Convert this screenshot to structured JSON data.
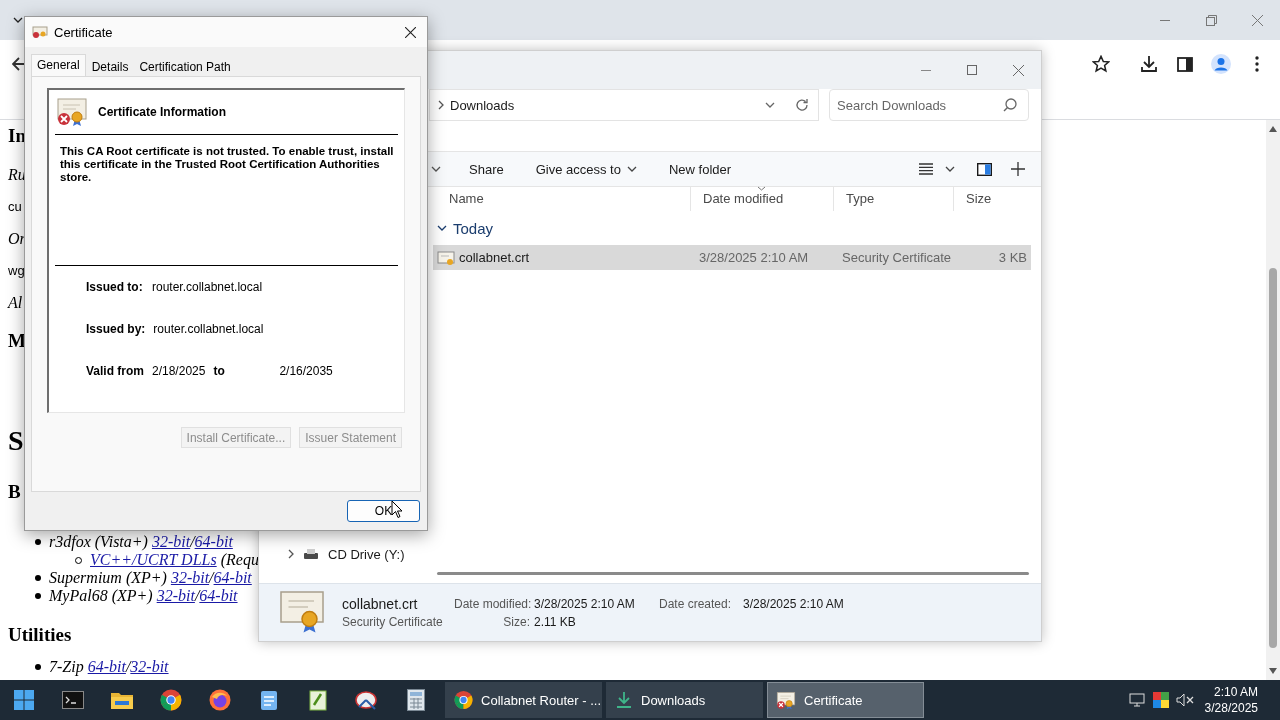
{
  "browser": {
    "page": {
      "blocks": [
        {
          "kind": "heading",
          "text": "In"
        },
        {
          "kind": "italic",
          "text": "Ru"
        },
        {
          "kind": "plain",
          "text": "cu"
        },
        {
          "kind": "italic",
          "text": "Or"
        },
        {
          "kind": "plain",
          "text": "wg"
        },
        {
          "kind": "italic",
          "text": "Al"
        },
        {
          "kind": "heading",
          "text": "M"
        },
        {
          "kind": "title",
          "text": "S"
        },
        {
          "kind": "heading",
          "text": "B"
        },
        {
          "kind": "list",
          "items": [
            {
              "parts": [
                {
                  "kind": "text",
                  "text": "r3dfox (Vista+) "
                },
                {
                  "kind": "link",
                  "text": "32-bit"
                },
                {
                  "kind": "text",
                  "text": "/"
                },
                {
                  "kind": "link",
                  "text": "64-bit"
                }
              ],
              "children": [
                {
                  "parts": [
                    {
                      "kind": "link",
                      "text": "VC++/UCRT DLLs"
                    },
                    {
                      "kind": "text",
                      "text": " (Requ"
                    }
                  ]
                }
              ]
            },
            {
              "parts": [
                {
                  "kind": "text",
                  "text": "Supermium (XP+) "
                },
                {
                  "kind": "link",
                  "text": "32-bit"
                },
                {
                  "kind": "text",
                  "text": "/"
                },
                {
                  "kind": "link",
                  "text": "64-bit"
                }
              ]
            },
            {
              "parts": [
                {
                  "kind": "text",
                  "text": "MyPal68 (XP+) "
                },
                {
                  "kind": "link",
                  "text": "32-bit"
                },
                {
                  "kind": "text",
                  "text": "/"
                },
                {
                  "kind": "link",
                  "text": "64-bit"
                }
              ]
            }
          ]
        },
        {
          "kind": "heading",
          "text": "Utilities"
        },
        {
          "kind": "list",
          "items": [
            {
              "parts": [
                {
                  "kind": "text",
                  "text": "7-Zip "
                },
                {
                  "kind": "link",
                  "text": "64-bit"
                },
                {
                  "kind": "text",
                  "text": "/"
                },
                {
                  "kind": "link",
                  "text": "32-bit"
                }
              ]
            }
          ]
        }
      ]
    }
  },
  "explorer": {
    "address": "Downloads",
    "search": {
      "placeholder": "Search Downloads"
    },
    "commands": [
      {
        "label": "Share",
        "dropdown": false
      },
      {
        "label": "Give access to",
        "dropdown": true
      },
      {
        "label": "New folder",
        "dropdown": false
      }
    ],
    "columns": [
      "Name",
      "Date modified",
      "Type",
      "Size"
    ],
    "group": {
      "label": "Today",
      "expanded": true
    },
    "files": [
      {
        "name": "collabnet.crt",
        "date": "3/28/2025 2:10 AM",
        "type": "Security Certificate",
        "size": "3 KB",
        "selected": true
      }
    ],
    "nav": [
      {
        "label": "CD Drive (Y:)",
        "expanded": false
      }
    ],
    "details": {
      "name": "collabnet.crt",
      "type": "Security Certificate",
      "fields": [
        {
          "label": "Date modified:",
          "value": "3/28/2025 2:10 AM"
        },
        {
          "label": "Size:",
          "value": "2.11 KB"
        },
        {
          "label": "Date created:",
          "value": "3/28/2025 2:10 AM"
        }
      ]
    }
  },
  "dialog": {
    "title": "Certificate",
    "tabs": [
      {
        "label": "General",
        "selected": true
      },
      {
        "label": "Details",
        "selected": false
      },
      {
        "label": "Certification Path",
        "selected": false
      }
    ],
    "heading": "Certificate Information",
    "message": "This CA Root certificate is not trusted. To enable trust, install this certificate in the Trusted Root Certification Authorities store.",
    "fields": [
      {
        "label": "Issued to:",
        "value": "router.collabnet.local"
      },
      {
        "label": "Issued by:",
        "value": "router.collabnet.local"
      }
    ],
    "validity": {
      "label": "Valid from",
      "from": "2/18/2025",
      "to_label": "to",
      "to": "2/16/2035"
    },
    "buttons": [
      {
        "label": "Install Certificate...",
        "disabled": true
      },
      {
        "label": "Issuer Statement",
        "disabled": true
      }
    ],
    "ok": "OK"
  },
  "taskbar": {
    "tasks": [
      {
        "label": "Collabnet Router - ...",
        "kind": "chrome",
        "selected": false
      },
      {
        "label": "Downloads",
        "kind": "downloads",
        "selected": false
      },
      {
        "label": "Certificate",
        "kind": "certificate",
        "selected": true
      }
    ],
    "clock": {
      "time": "2:10 AM",
      "date": "3/28/2025"
    }
  }
}
